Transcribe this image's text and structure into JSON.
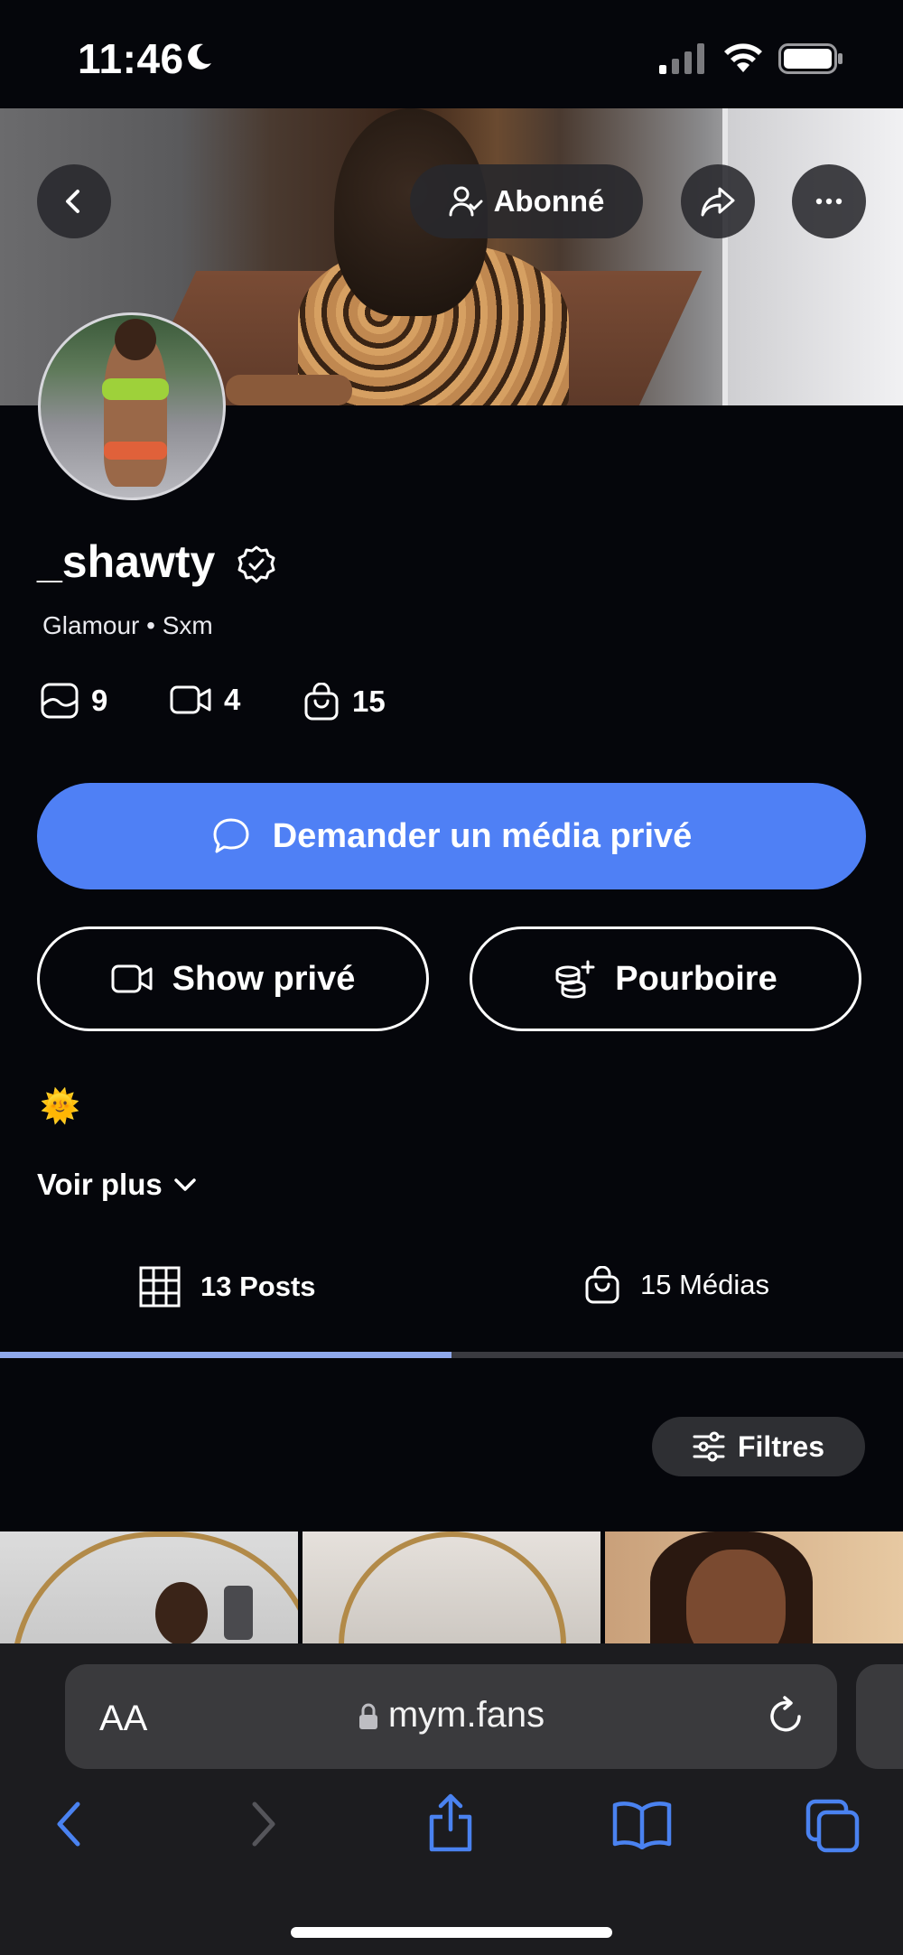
{
  "status_bar": {
    "time": "11:46"
  },
  "profile": {
    "subscribe_label": "Abonné",
    "username": "_shawty",
    "subtitle": "Glamour • Sxm",
    "stats": {
      "photos": "9",
      "videos": "4",
      "media_purchases": "15"
    },
    "bio_emoji": "🌞",
    "see_more": "Voir plus"
  },
  "actions": {
    "private_media": "Demander un média privé",
    "private_show": "Show privé",
    "tip": "Pourboire"
  },
  "tabs": [
    {
      "label": "13 Posts",
      "active": true
    },
    {
      "label": "15 Médias",
      "active": false
    }
  ],
  "filters_label": "Filtres",
  "browser": {
    "aa_label": "AA",
    "url": "mym.fans"
  },
  "colors": {
    "accent": "#4f80f5",
    "background": "#05060b",
    "tab_indicator": "#8fa8ec"
  }
}
